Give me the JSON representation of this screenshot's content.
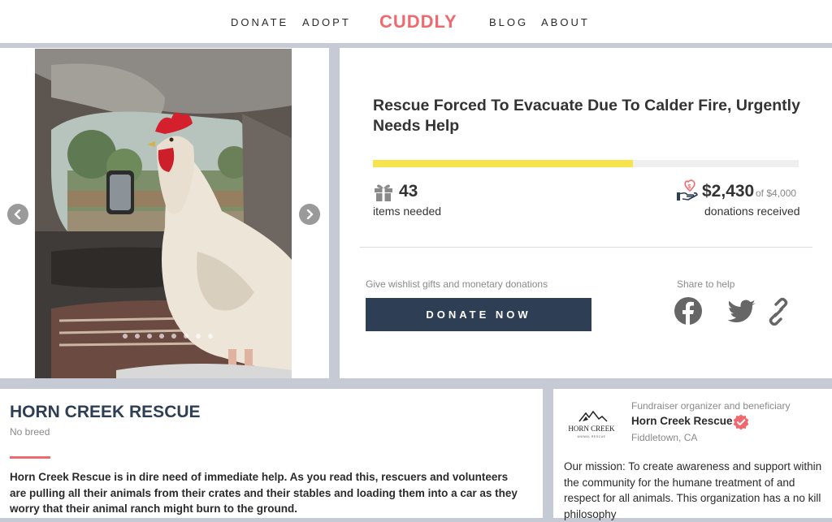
{
  "nav": {
    "donate": "DONATE",
    "adopt": "ADOPT",
    "logo": "CUDDLY",
    "blog": "BLOG",
    "about": "ABOUT"
  },
  "carousel": {
    "prev_icon": "chevron-left-icon",
    "next_icon": "chevron-right-icon",
    "dot_count": 8
  },
  "fundraiser": {
    "title": "Rescue Forced To Evacuate Due To Calder Fire, Urgently Needs Help",
    "progress_fraction": 0.61,
    "items_needed": "43",
    "items_label": "items needed",
    "raised": "$2,430",
    "goal_prefix": "of",
    "goal": "$4,000",
    "donations_label": "donations received",
    "donate_hint": "Give wishlist gifts and monetary donations",
    "donate_button": "DONATE NOW",
    "share_label": "Share to help"
  },
  "description": {
    "org_title": "HORN CREEK RESCUE",
    "breed": "No breed",
    "story": "Horn Creek Rescue is in dire need of immediate help. As you read this, rescuers and volunteers are pulling all their animals from their crates and their stables and loading them into a car as they worry that their animal ranch might burn to the ground."
  },
  "organizer": {
    "logo_text": "HORN CREEK",
    "logo_subtext": "ANIMAL RESCUE",
    "caption": "Fundraiser organizer and beneficiary",
    "name": "Horn Creek Rescue",
    "location": "Fiddletown,  CA",
    "mission": "Our mission: To create awareness and support within the community for the humane treatment of and respect for all animals. This organization has a no kill philosophy"
  },
  "colors": {
    "brand": "#ee6a6e",
    "navy": "#2d3e55",
    "progress": "#f7e34c",
    "page_bg": "#c5cad5"
  }
}
